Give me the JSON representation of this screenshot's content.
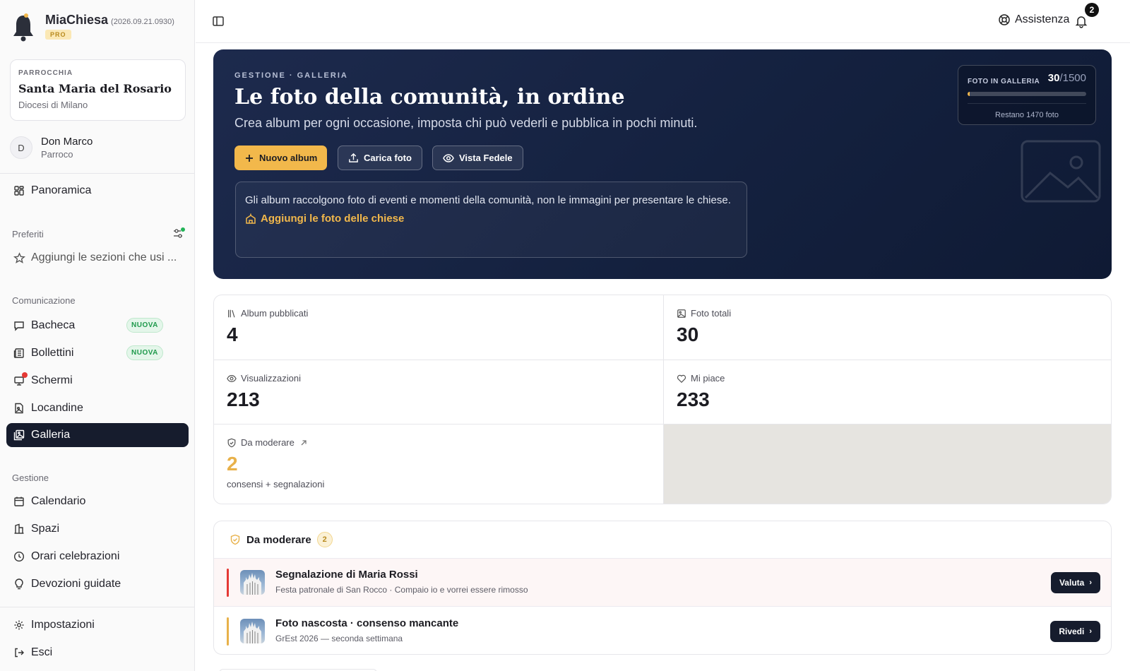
{
  "app": {
    "name": "MiaChiesa",
    "version": "(2026.09.21.0930)",
    "plan": "PRO"
  },
  "parish": {
    "label": "PARROCCHIA",
    "name": "Santa Maria del Rosario",
    "diocese": "Diocesi di Milano"
  },
  "user": {
    "initial": "D",
    "name": "Don Marco",
    "role": "Parroco"
  },
  "sidebar": {
    "overview": "Panoramica",
    "favorites_label": "Preferiti",
    "favorites_hint": "Aggiungi le sezioni che usi ...",
    "communication_label": "Comunicazione",
    "communication": [
      {
        "label": "Bacheca",
        "badge": "NUOVA",
        "icon": "message-square-icon"
      },
      {
        "label": "Bollettini",
        "badge": "NUOVA",
        "icon": "newspaper-icon"
      },
      {
        "label": "Schermi",
        "icon": "monitor-icon"
      },
      {
        "label": "Locandine",
        "icon": "file-image-icon"
      },
      {
        "label": "Galleria",
        "icon": "gallery-icon",
        "active": true
      }
    ],
    "management_label": "Gestione",
    "management": [
      {
        "label": "Calendario",
        "icon": "calendar-icon"
      },
      {
        "label": "Spazi",
        "icon": "building-icon"
      },
      {
        "label": "Orari celebrazioni",
        "icon": "clock-icon"
      },
      {
        "label": "Devozioni guidate",
        "icon": "lightbulb-icon"
      }
    ],
    "settings": "Impostazioni",
    "logout": "Esci"
  },
  "topbar": {
    "help": "Assistenza",
    "notifications": "2"
  },
  "hero": {
    "eyebrow": "GESTIONE · GALLERIA",
    "title": "Le foto della comunità, in ordine",
    "subtitle": "Crea album per ogni occasione, imposta chi può vederli e pubblica in pochi minuti.",
    "btn_new_album": "Nuovo album",
    "btn_upload": "Carica foto",
    "btn_view": "Vista Fedele",
    "note": "Gli album raccolgono foto di eventi e momenti della comunità, non le immagini per presentare le chiese.",
    "note_link": "Aggiungi le foto delle chiese",
    "quota_label": "FOTO IN GALLERIA",
    "quota_used": "30",
    "quota_total": "/1500",
    "quota_fraction": 0.02,
    "quota_remaining": "Restano 1470 foto"
  },
  "stats": {
    "albums_label": "Album pubblicati",
    "albums_value": "4",
    "photos_label": "Foto totali",
    "photos_value": "30",
    "views_label": "Visualizzazioni",
    "views_value": "213",
    "likes_label": "Mi piace",
    "likes_value": "233",
    "moderate_label": "Da moderare",
    "moderate_value": "2",
    "moderate_note": "consensi + segnalazioni"
  },
  "moderation": {
    "title": "Da moderare",
    "count": "2",
    "items": [
      {
        "title": "Segnalazione di Maria Rossi",
        "subtitle": "Festa patronale di San Rocco · Compaio io e vorrei essere rimosso",
        "action": "Valuta",
        "accent": "#e53935"
      },
      {
        "title": "Foto nascosta · consenso mancante",
        "subtitle": "GrEst 2026 — seconda settimana",
        "action": "Rivedi",
        "accent": "#e8b14a"
      }
    ]
  },
  "colors": {
    "accent": "#f2b84b",
    "nav_active": "#161c2d",
    "hero_bg": "#14213f",
    "new_badge": "#1f9a4c"
  }
}
